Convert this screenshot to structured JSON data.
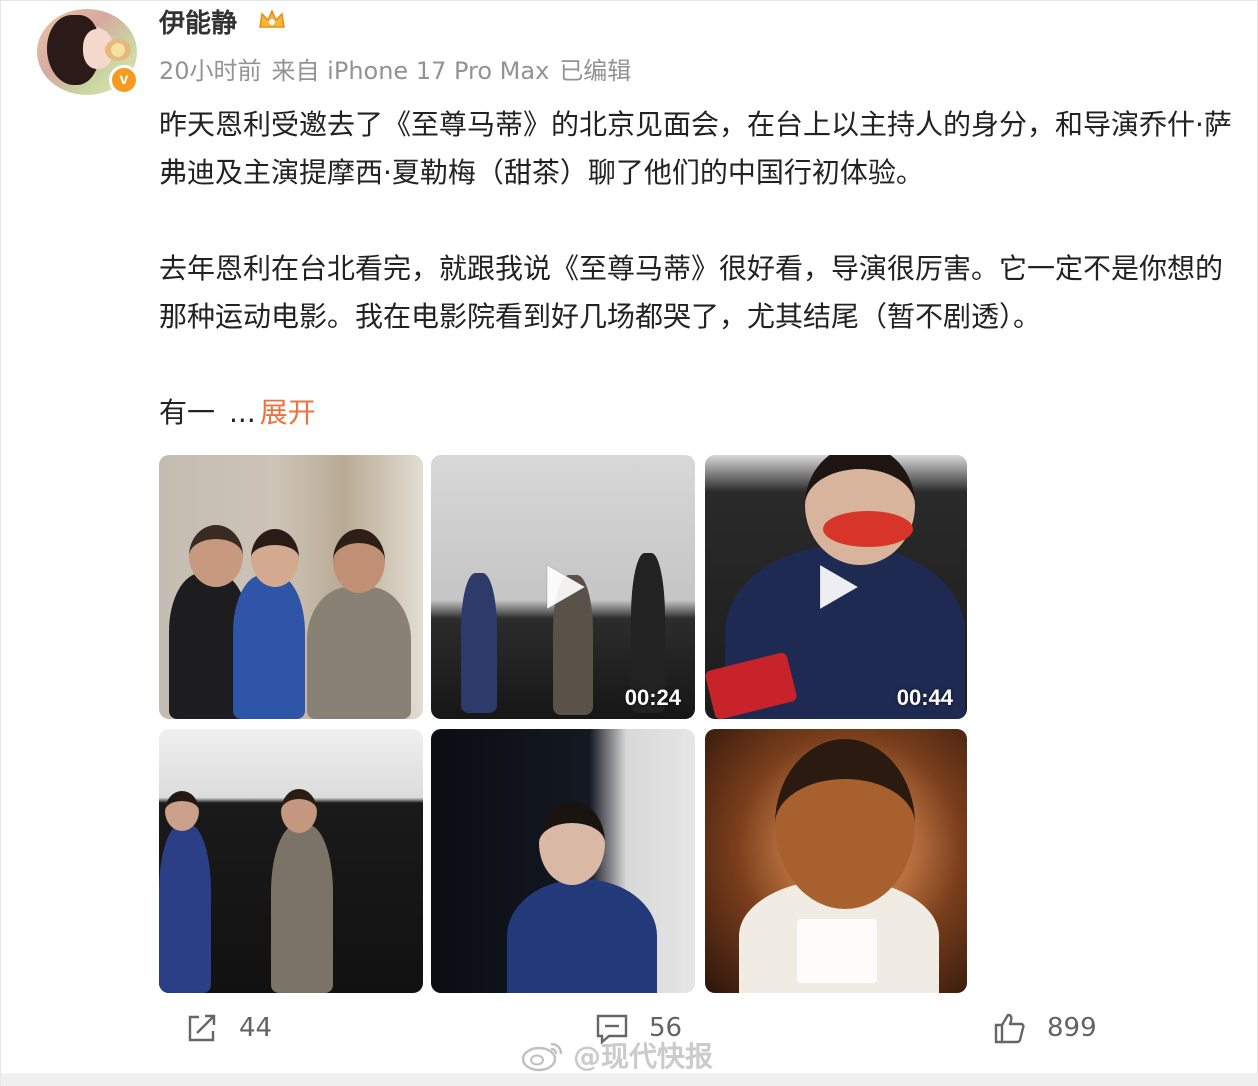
{
  "post": {
    "author": "伊能静",
    "timestamp": "20小时前",
    "source": "来自 iPhone 17 Pro Max",
    "edited": "已编辑",
    "paragraph1": "昨天恩利受邀去了《至尊马蒂》的北京见面会，在台上以主持人的身分，和导演乔什·萨弗迪及主演提摩西·夏勒梅（甜茶）聊了他们的中国行初体验。",
    "paragraph2": "去年恩利在台北看完，就跟我说《至尊马蒂》很好看，导演很厉害。它一定不是你想的那种运动电影。我在电影院看到好几场都哭了，尤其结尾（暂不剧透）。",
    "truncated_text": "有一",
    "ellipsis": "...",
    "expand_label": "展开"
  },
  "media": {
    "tiles": [
      {
        "type": "photo",
        "duration": ""
      },
      {
        "type": "video",
        "duration": "00:24"
      },
      {
        "type": "video",
        "duration": "00:44"
      },
      {
        "type": "photo",
        "duration": ""
      },
      {
        "type": "photo",
        "duration": ""
      },
      {
        "type": "photo",
        "duration": ""
      }
    ]
  },
  "actions": {
    "repost_count": "44",
    "comment_count": "56",
    "like_count": "899"
  },
  "watermark": {
    "text": "@现代快报"
  },
  "colors": {
    "link": "#eb7340",
    "meta": "#939393",
    "verify": "#f79a20"
  },
  "icons": {
    "verify": "verified-v-badge",
    "member": "crown-icon",
    "repost": "repost-icon",
    "comment": "comment-icon",
    "like": "thumbs-up-icon",
    "play": "play-icon"
  }
}
